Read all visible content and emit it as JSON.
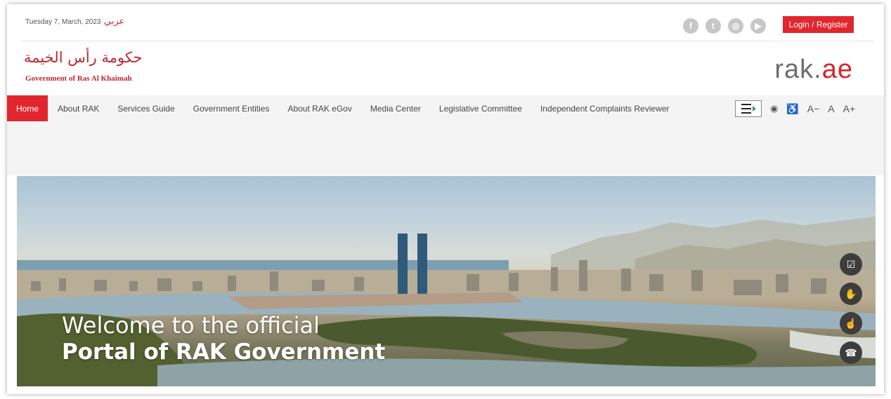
{
  "topbar": {
    "date": "Tuesday 7, March, 2023",
    "language_link": "عربي",
    "socials": [
      {
        "icon": "facebook-icon",
        "glyph": "f"
      },
      {
        "icon": "twitter-icon",
        "glyph": "t"
      },
      {
        "icon": "instagram-icon",
        "glyph": "◎"
      },
      {
        "icon": "youtube-icon",
        "glyph": "▶"
      }
    ],
    "login_label": "Login / Register"
  },
  "header": {
    "logo_arabic": "حكومة رأس الخيمة",
    "logo_english": "Government of Ras Al Khaimah",
    "site_logo_main": "rak.",
    "site_logo_accent": "ae"
  },
  "nav": {
    "items": [
      {
        "label": "Home"
      },
      {
        "label": "About RAK"
      },
      {
        "label": "Services Guide"
      },
      {
        "label": "Government Entities"
      },
      {
        "label": "About RAK eGov"
      },
      {
        "label": "Media Center"
      },
      {
        "label": "Legislative Committee"
      },
      {
        "label": "Independent Complaints Reviewer"
      }
    ],
    "tools": {
      "eye_glyph": "◉",
      "accessibility_glyph": "♿",
      "font_decrease": "A−",
      "font_reset": "A",
      "font_increase": "A+"
    }
  },
  "hero": {
    "line1": "Welcome to the official",
    "line2": "Portal of RAK Government"
  },
  "floating_buttons": [
    {
      "icon": "checklist-icon",
      "glyph": "☑"
    },
    {
      "icon": "hand-icon",
      "glyph": "✋"
    },
    {
      "icon": "feedback-icon",
      "glyph": "☝"
    },
    {
      "icon": "phone-icon",
      "glyph": "☎"
    }
  ],
  "colors": {
    "brand_red": "#e1262d",
    "logo_grey": "#6d6e70",
    "nav_background": "#f4f4f4"
  }
}
